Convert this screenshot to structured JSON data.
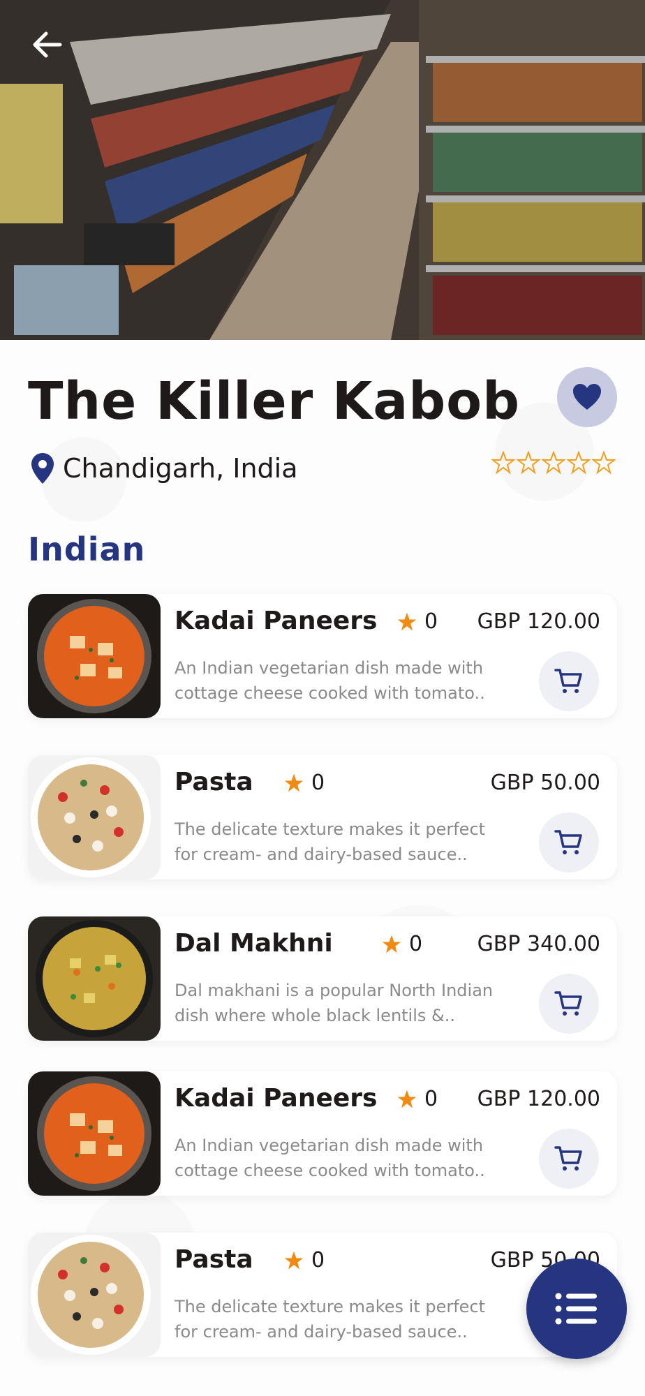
{
  "restaurant": {
    "name": "The Killer Kabob",
    "location": "Chandigarh, India",
    "rating_stars": 0
  },
  "section_title": "Indian",
  "items": [
    {
      "name": "Kadai Paneers",
      "rating": "0",
      "price": "GBP 120.00",
      "desc": "An Indian vegetarian dish made with cottage cheese cooked with tomato..",
      "image": "paneer-curry"
    },
    {
      "name": "Pasta",
      "rating": "0",
      "price": "GBP 50.00",
      "desc": "The delicate texture makes it perfect for cream- and dairy-based sauce..",
      "image": "pasta-salad"
    },
    {
      "name": "Dal Makhni",
      "rating": "0",
      "price": "GBP 340.00",
      "desc": "Dal makhani is a popular North Indian dish where whole black lentils &..",
      "image": "veg-curry"
    },
    {
      "name": "Kadai Paneers",
      "rating": "0",
      "price": "GBP 120.00",
      "desc": "An Indian vegetarian dish made with cottage cheese cooked with tomato..",
      "image": "paneer-curry"
    },
    {
      "name": "Pasta",
      "rating": "0",
      "price": "GBP 50.00",
      "desc": "The delicate texture makes it perfect for cream- and dairy-based sauce..",
      "image": "pasta-salad"
    }
  ],
  "colors": {
    "accent": "#263580",
    "star": "#f0a020",
    "fav_bg": "#c7cae0"
  },
  "icons": {
    "back": "arrow-left-icon",
    "favorite": "heart-icon",
    "location": "map-pin-icon",
    "cart": "shopping-cart-icon",
    "menu": "list-menu-icon"
  }
}
